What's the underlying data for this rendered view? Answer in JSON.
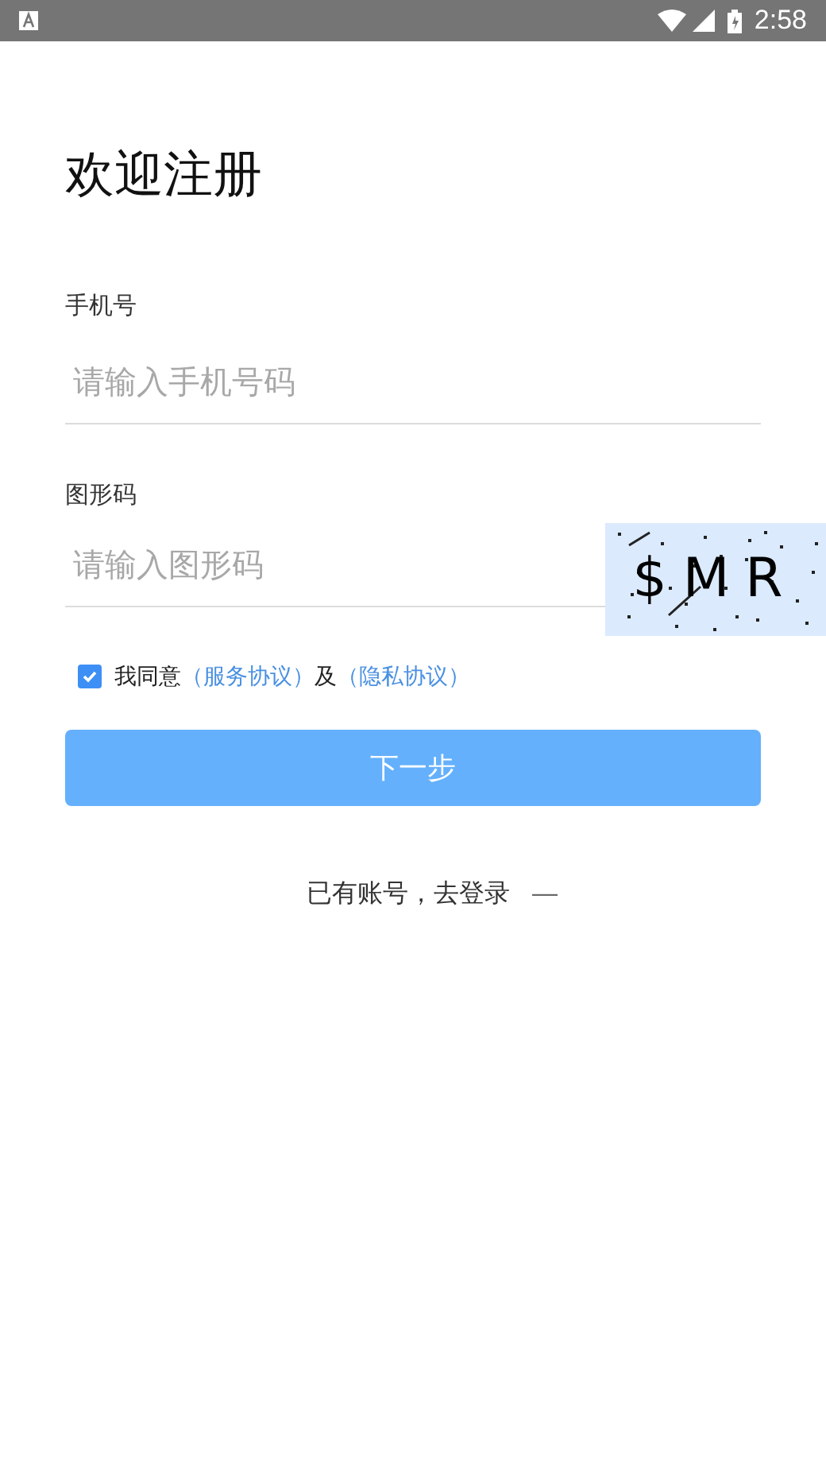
{
  "status_bar": {
    "time": "2:58"
  },
  "title": "欢迎注册",
  "phone": {
    "label": "手机号",
    "placeholder": "请输入手机号码"
  },
  "captcha_field": {
    "label": "图形码",
    "placeholder": "请输入图形码",
    "captcha": "$MR"
  },
  "agreement": {
    "checked": true,
    "text": "我同意",
    "link1": "（服务协议）",
    "and": "及",
    "link2": "（隐私协议）"
  },
  "next_button": "下一步",
  "login_link": {
    "text": "已有账号，去登录",
    "dash": "—"
  }
}
